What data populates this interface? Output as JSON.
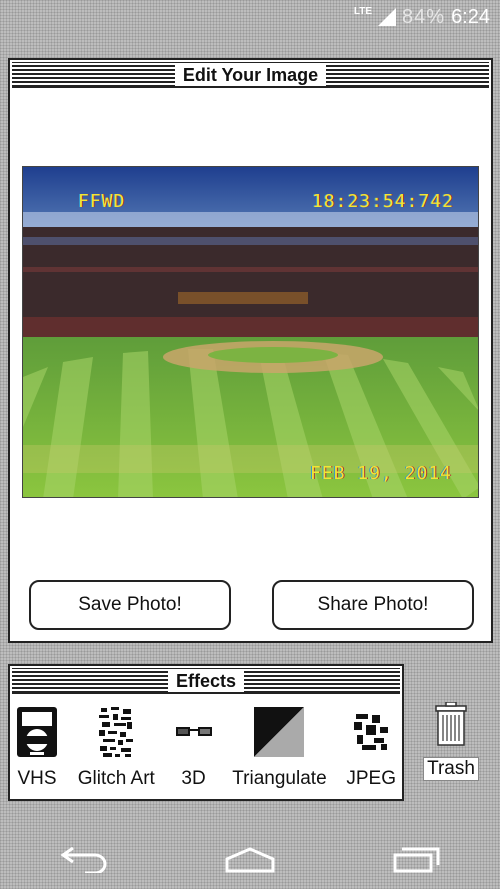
{
  "status_bar": {
    "network": "LTE",
    "battery": "84%",
    "time": "6:24"
  },
  "main_window": {
    "title": "Edit Your Image",
    "photo": {
      "osd_mode": "FFWD",
      "osd_time": "18:23:54:742",
      "osd_date": "FEB 19, 2014",
      "osd_color": "#f2e634"
    },
    "buttons": {
      "save_label": "Save Photo!",
      "share_label": "Share Photo!"
    }
  },
  "effects_window": {
    "title": "Effects",
    "items": [
      {
        "label": "VHS",
        "icon": "vhs-cassette-icon"
      },
      {
        "label": "Glitch Art",
        "icon": "glitch-pattern-icon"
      },
      {
        "label": "3D",
        "icon": "3d-glasses-icon"
      },
      {
        "label": "Triangulate",
        "icon": "triangle-split-icon"
      },
      {
        "label": "JPEG",
        "icon": "jpeg-blocks-icon"
      }
    ]
  },
  "trash": {
    "label": "Trash",
    "icon": "trash-can-icon"
  },
  "nav_bar": {
    "icons": [
      "back-icon",
      "home-icon",
      "recents-icon"
    ]
  }
}
